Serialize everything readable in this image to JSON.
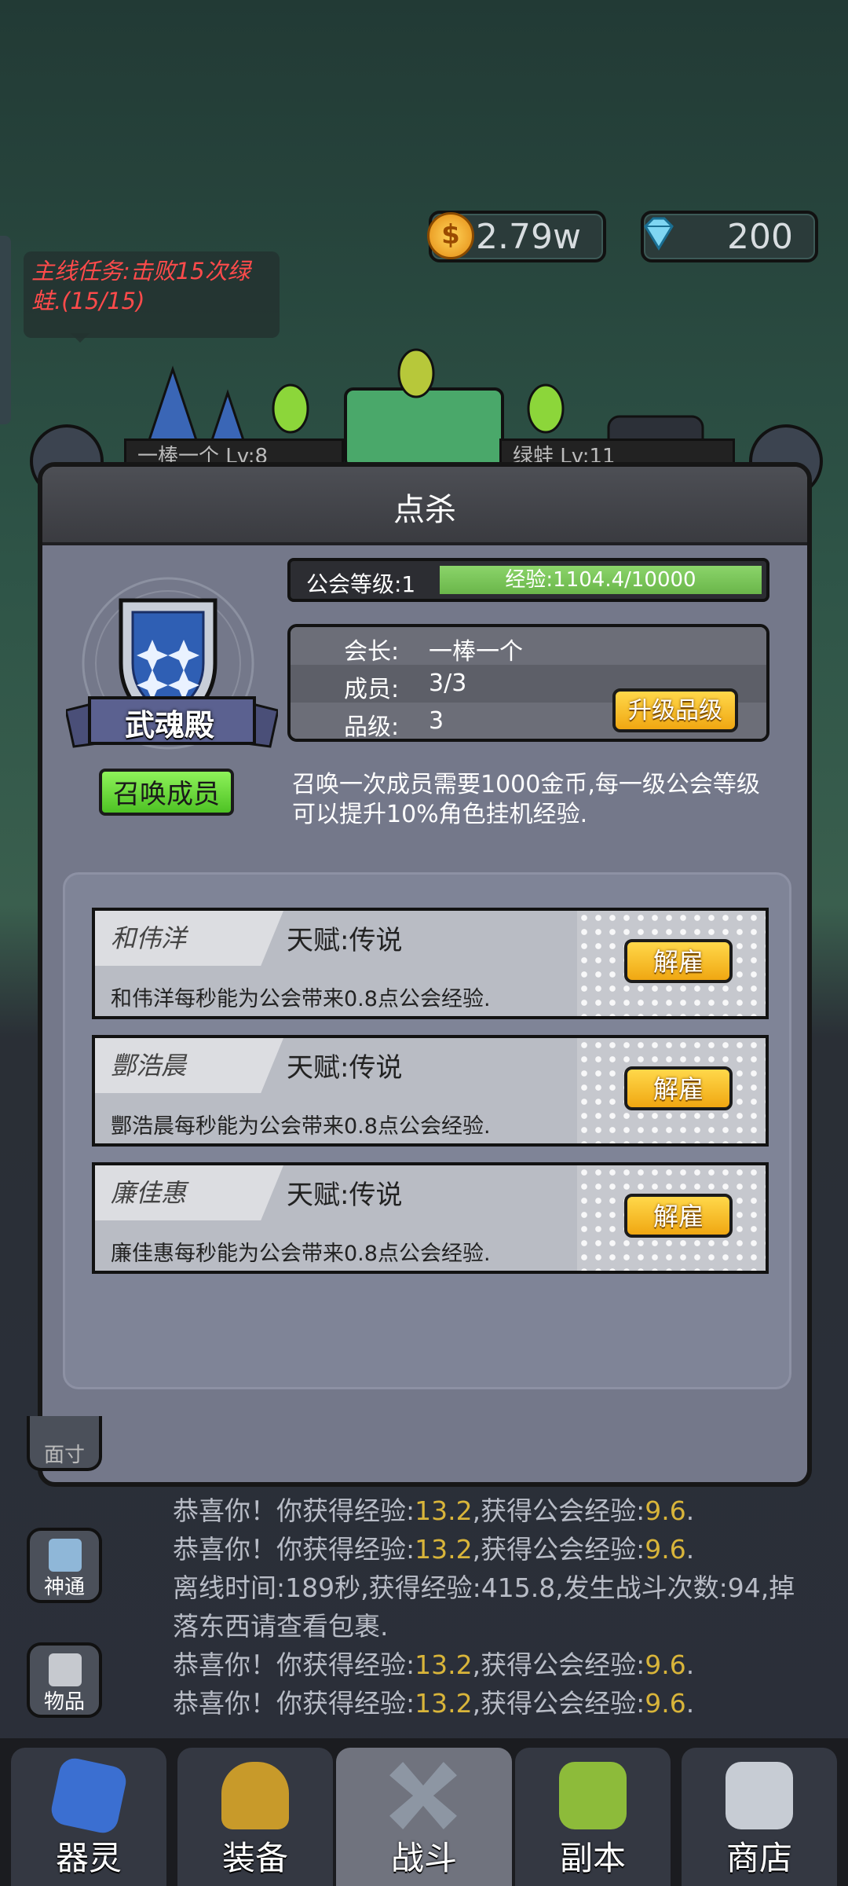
{
  "currency": {
    "gold": "2.79w",
    "gems": "200"
  },
  "quest": {
    "text": "主线任务:击败15次绿蛙.(15/15)"
  },
  "battle": {
    "left_name": "一棒一个 Lv:8",
    "right_name": "绿蛙 Lv:11"
  },
  "modal": {
    "title": "点杀",
    "guild_badge": "武魂殿",
    "summon_button": "召唤成员",
    "level_label": "公会等级:1",
    "exp_text": "经验:1104.4/10000",
    "exp_ratio": 0.11,
    "info": [
      {
        "key": "会长:",
        "value": "一棒一个"
      },
      {
        "key": "成员:",
        "value": "3/3"
      },
      {
        "key": "品级:",
        "value": "3"
      }
    ],
    "upgrade_button": "升级品级",
    "description": "召唤一次成员需要1000金币,每一级公会等级可以提升10%角色挂机经验.",
    "members": [
      {
        "name": "和伟洋",
        "talent": "天赋:传说",
        "desc": "和伟洋每秒能为公会带来0.8点公会经验.",
        "button": "解雇"
      },
      {
        "name": "酆浩晨",
        "talent": "天赋:传说",
        "desc": "酆浩晨每秒能为公会带来0.8点公会经验.",
        "button": "解雇"
      },
      {
        "name": "廉佳惠",
        "talent": "天赋:传说",
        "desc": "廉佳惠每秒能为公会带来0.8点公会经验.",
        "button": "解雇"
      }
    ]
  },
  "log": [
    {
      "a": "恭喜你！你获得经验:",
      "b": "13.2",
      "c": ",获得公会经验:",
      "d": "9.6",
      "e": "."
    },
    {
      "a": "恭喜你！你获得经验:",
      "b": "13.2",
      "c": ",获得公会经验:",
      "d": "9.6",
      "e": "."
    },
    {
      "plain": "离线时间:189秒,获得经验:415.8,发生战斗次数:94,掉落东西请查看包裹."
    },
    {
      "a": "恭喜你！你获得经验:",
      "b": "13.2",
      "c": ",获得公会经验:",
      "d": "9.6",
      "e": "."
    },
    {
      "a": "恭喜你！你获得经验:",
      "b": "13.2",
      "c": ",获得公会经验:",
      "d": "9.6",
      "e": "."
    }
  ],
  "side": {
    "partial": "面寸",
    "shentong": "神通",
    "items": "物品"
  },
  "nav": [
    "器灵",
    "装备",
    "战斗",
    "副本",
    "商店"
  ],
  "colors": {
    "highlight": "#d9b53a",
    "quest": "#ff4b4b"
  }
}
